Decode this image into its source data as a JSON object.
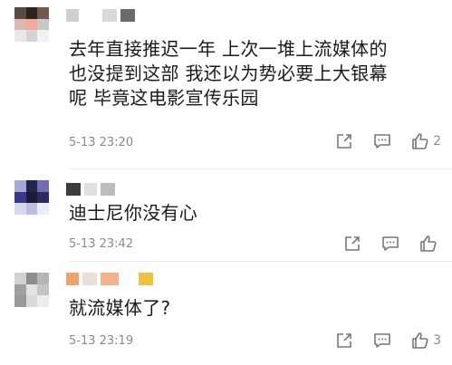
{
  "comments": [
    {
      "text_lines": [
        "去年直接推迟一年 上次一堆上流媒体的",
        "也没提到这部 我还以为势必要上大银幕",
        "呢 毕竟这电影宣传乐园"
      ],
      "timestamp": "5-13 23:20",
      "like_count": "2",
      "avatar_colors": [
        "#5a4a3f",
        "#2b2222",
        "#6f5a50",
        "#d7b9b2",
        "#f2a99a",
        "#c8c8c8",
        "#e9e9e9",
        "#d4d4d4",
        "#f2f2f2"
      ],
      "name_colors": [
        "#cfcfcf",
        "#ffffff",
        "#d9d9d9",
        "#6a6a6a"
      ]
    },
    {
      "text_lines": [
        "迪士尼你没有心"
      ],
      "timestamp": "5-13 23:42",
      "like_count": "",
      "avatar_colors": [
        "#a7a7d8",
        "#26234a",
        "#6f6db3",
        "#3a3a8c",
        "#1d1a3a",
        "#2c2a5e",
        "#d8d8ee",
        "#bdbde0",
        "#ececf7"
      ],
      "name_colors": [
        "#3d3d3d",
        "#e0e0e0",
        "#bdbdbd"
      ]
    },
    {
      "text_lines": [
        "就流媒体了?"
      ],
      "timestamp": "5-13 23:19",
      "like_count": "3",
      "avatar_colors": [
        "#d2d2d2",
        "#8d8d8d",
        "#b5b5b5",
        "#a0a0a0",
        "#e3e3e3",
        "#c4c4c4",
        "#9a9a9a",
        "#d9d9d9",
        "#ececec"
      ],
      "name_colors": [
        "#f0a36a",
        "#e8e0d8",
        "#f4b38a",
        "#ffffff",
        "#f0c040"
      ]
    }
  ],
  "icons": {
    "share": "share-icon",
    "comment": "comment-icon",
    "like": "thumbs-up-icon"
  }
}
